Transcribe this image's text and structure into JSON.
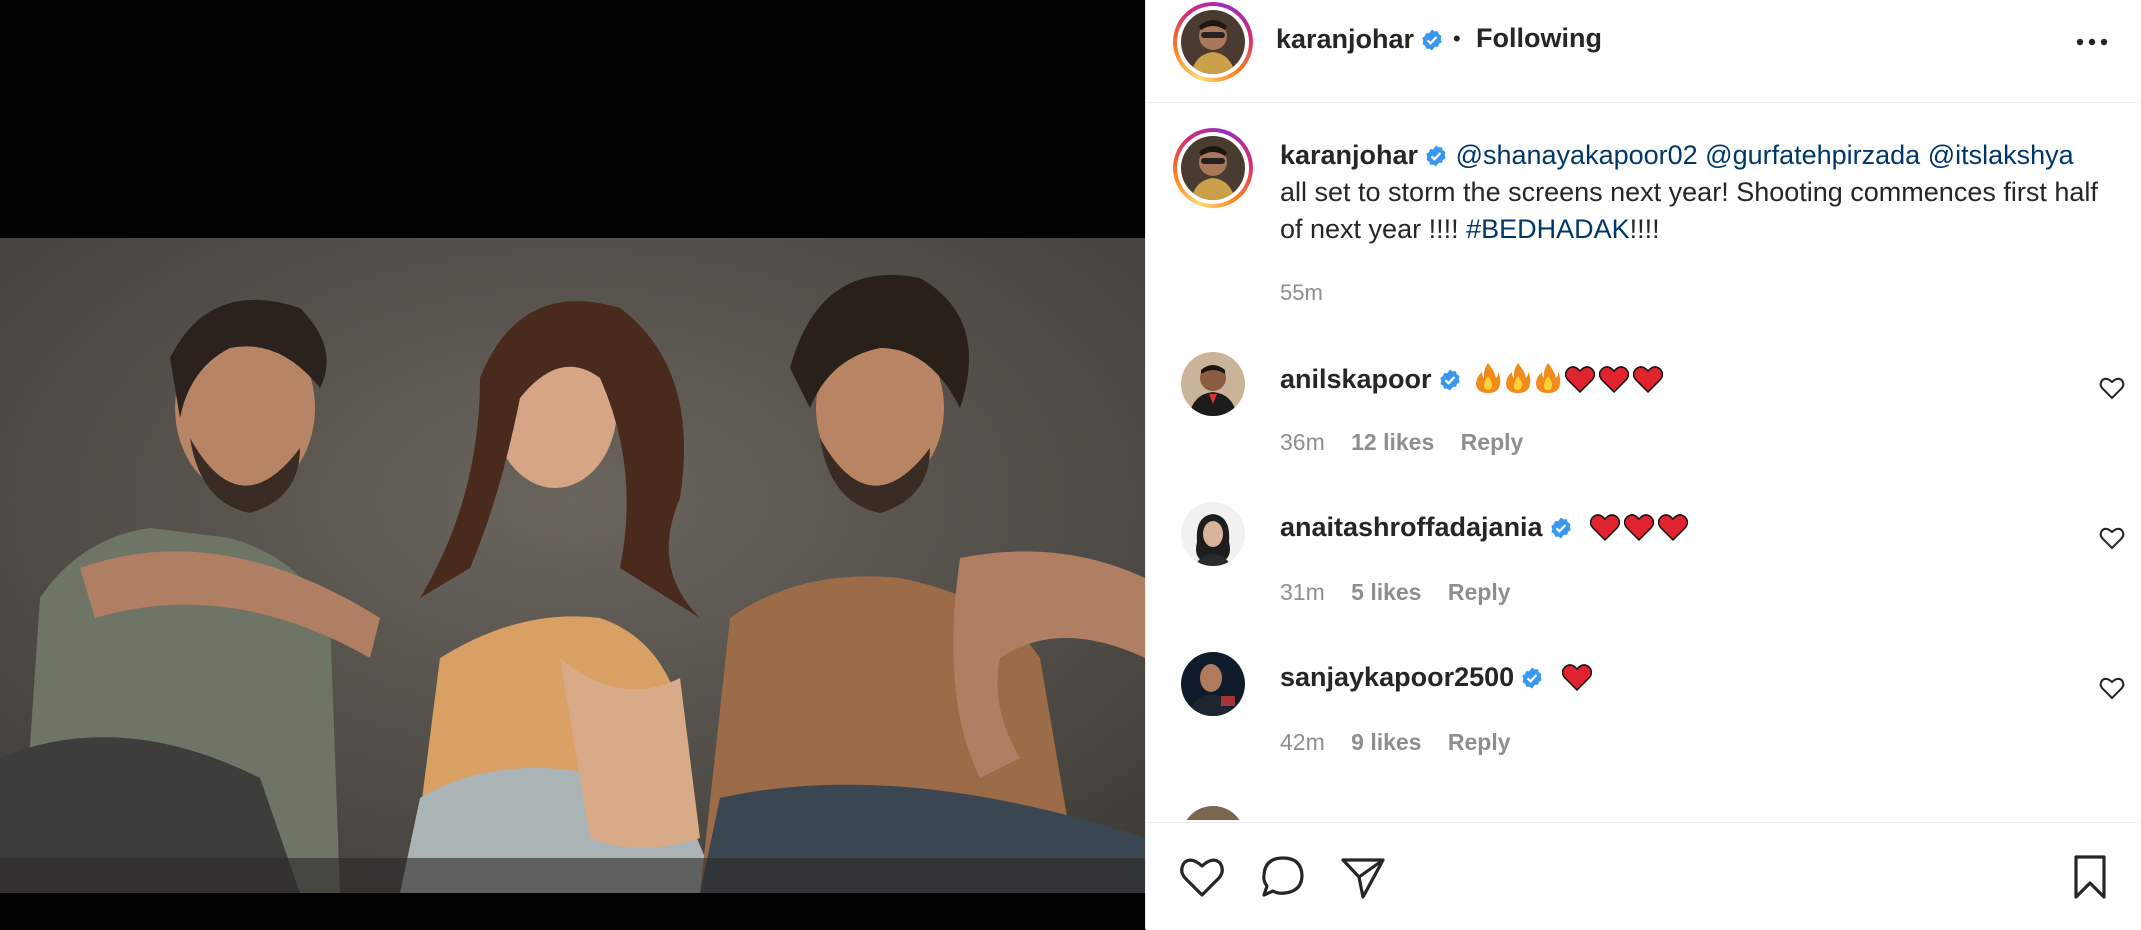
{
  "post": {
    "author": "karanjohar",
    "separator": "•",
    "follow_status": "Following",
    "caption_mentions": "@shanayakapoor02 @gurfatehpirzada @itslakshya",
    "caption_text": "all set to storm the screens next year! Shooting commences first half of next year !!!!",
    "caption_hashtag": "#BEDHADAK",
    "caption_tail": "!!!!",
    "time": "55m"
  },
  "comments": [
    {
      "user": "anilskapoor",
      "emojis": [
        "fire",
        "fire",
        "fire",
        "heart",
        "heart",
        "heart"
      ],
      "time": "36m",
      "likes": "12 likes",
      "reply": "Reply"
    },
    {
      "user": "anaitashroffadajania",
      "emojis": [
        "heart",
        "heart",
        "heart"
      ],
      "time": "31m",
      "likes": "5 likes",
      "reply": "Reply"
    },
    {
      "user": "sanjaykapoor2500",
      "emojis": [
        "heart"
      ],
      "time": "42m",
      "likes": "9 likes",
      "reply": "Reply"
    }
  ],
  "icons": {
    "more": "more-options-icon",
    "like": "heart-icon",
    "comment": "comment-icon",
    "share": "send-icon",
    "save": "bookmark-icon",
    "verified": "verified-badge-icon"
  },
  "colors": {
    "link": "#00376b",
    "verified": "#3897f0",
    "emoji_heart": "#e0242f",
    "muted": "#8e8e8e"
  }
}
